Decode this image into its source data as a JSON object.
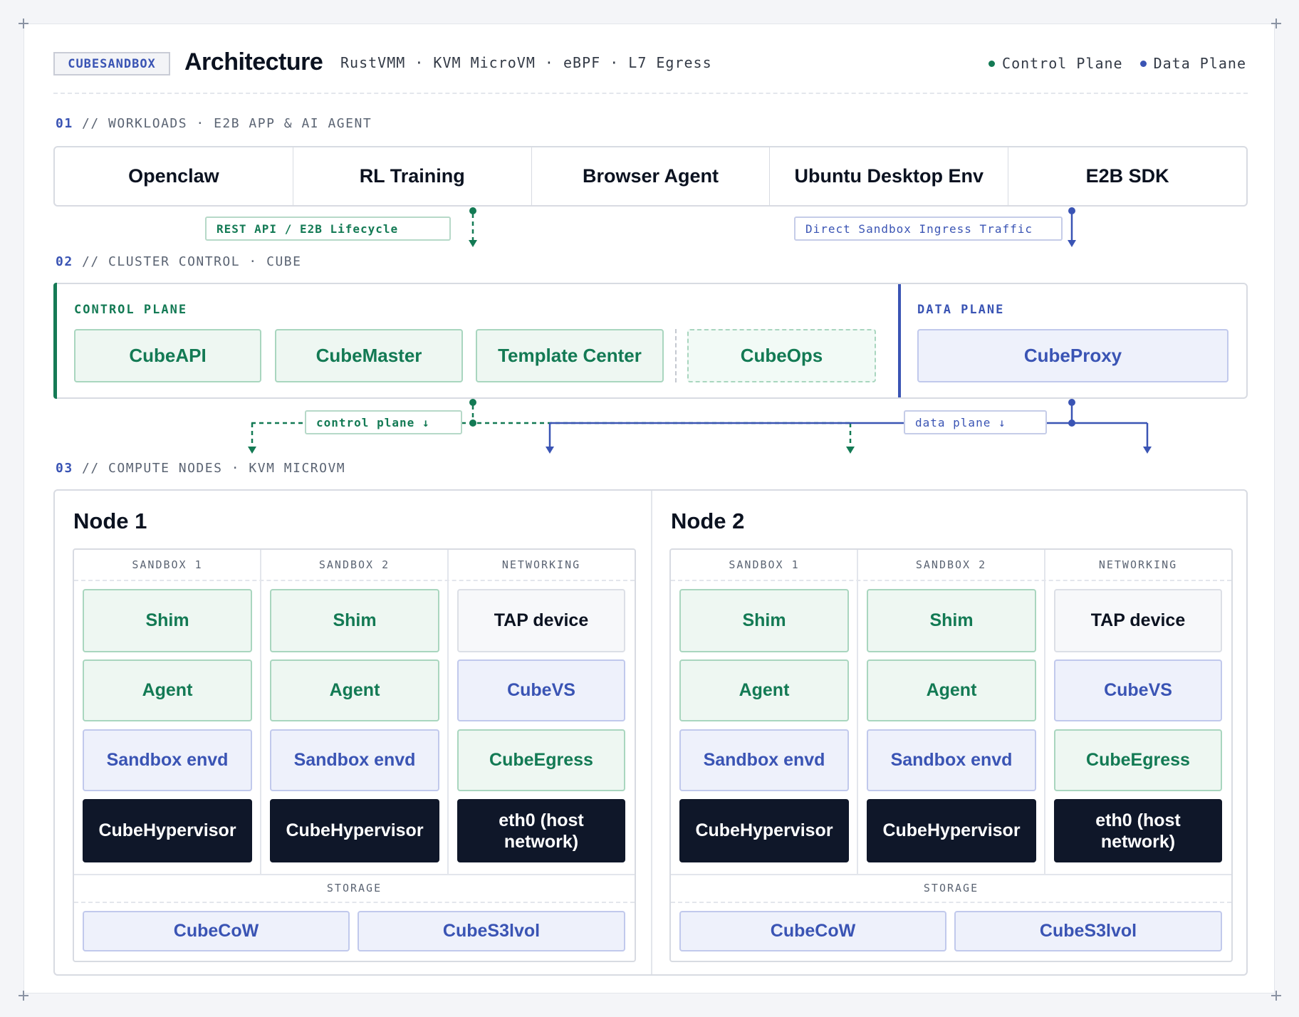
{
  "header": {
    "brand_tag": "CUBESANDBOX",
    "title": "Architecture",
    "subtitle": "RustVMM · KVM MicroVM · eBPF · L7 Egress",
    "legend": [
      {
        "label": "Control Plane",
        "color": "#137a54"
      },
      {
        "label": "Data Plane",
        "color": "#3a54b4"
      }
    ]
  },
  "sections": {
    "s1": {
      "num": "01",
      "label": "// WORKLOADS · E2B APP & AI AGENT"
    },
    "s2": {
      "num": "02",
      "label": "// CLUSTER CONTROL · CUBE"
    },
    "s3": {
      "num": "03",
      "label": "// COMPUTE NODES · KVM MICROVM"
    }
  },
  "workloads": [
    "Openclaw",
    "RL Training",
    "Browser Agent",
    "Ubuntu Desktop Env",
    "E2B SDK"
  ],
  "connectors": {
    "rest_api": "REST API / E2B Lifecycle",
    "ingress": "Direct Sandbox Ingress Traffic",
    "control_plane": "control plane ↓",
    "data_plane": "data plane ↓"
  },
  "cluster": {
    "control_label": "CONTROL PLANE",
    "data_label": "DATA PLANE",
    "control_components": [
      "CubeAPI",
      "CubeMaster",
      "Template Center",
      "CubeOps"
    ],
    "data_components": [
      "CubeProxy"
    ]
  },
  "nodes": [
    {
      "title": "Node 1",
      "columns": [
        "SANDBOX 1",
        "SANDBOX 2",
        "NETWORKING"
      ],
      "sandbox": [
        "Shim",
        "Agent",
        "Sandbox envd",
        "CubeHypervisor"
      ],
      "networking": [
        "TAP device",
        "CubeVS",
        "CubeEgress",
        "eth0 (host network)"
      ],
      "storage_label": "STORAGE",
      "storage": [
        "CubeCoW",
        "CubeS3lvol"
      ]
    },
    {
      "title": "Node 2",
      "columns": [
        "SANDBOX 1",
        "SANDBOX 2",
        "NETWORKING"
      ],
      "sandbox": [
        "Shim",
        "Agent",
        "Sandbox envd",
        "CubeHypervisor"
      ],
      "networking": [
        "TAP device",
        "CubeVS",
        "CubeEgress",
        "eth0 (host network)"
      ],
      "storage_label": "STORAGE",
      "storage": [
        "CubeCoW",
        "CubeS3lvol"
      ]
    }
  ],
  "colors": {
    "control": "#137a54",
    "data": "#3a54b4",
    "dark": "#0f1729"
  }
}
